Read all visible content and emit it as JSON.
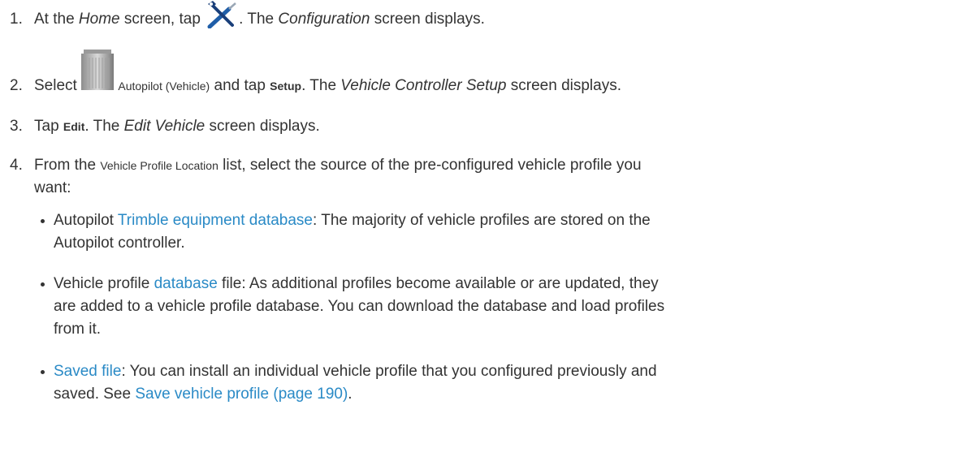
{
  "steps": [
    {
      "number": "1.",
      "p1": "At the ",
      "home": "Home",
      "p2": " screen, tap ",
      "p3": ". The ",
      "configuration": "Configuration",
      "p4": " screen displays.",
      "icon": "wrench-screwdriver-icon"
    },
    {
      "number": "2.",
      "p1": "Select ",
      "autopilot": "Autopilot (Vehicle)",
      "p2": " and tap ",
      "setup": "Setup",
      "p3": ". The ",
      "vcs": "Vehicle Controller Setup",
      "p4": " screen displays.",
      "icon": "autopilot-controller-icon"
    },
    {
      "number": "3.",
      "p1": "Tap ",
      "edit": "Edit",
      "p2": ". The ",
      "edit_vehicle": "Edit Vehicle",
      "p3": " screen displays."
    },
    {
      "number": "4.",
      "p1": "From the ",
      "vpl": "Vehicle Profile Location",
      "p2": " list, select the source of the pre-configured vehicle profile you",
      "line2": "want:"
    }
  ],
  "bullets": [
    {
      "pre": "Autopilot ",
      "link": "Trimble equipment database",
      "post": ": The majority of vehicle profiles are stored on the",
      "line2": "Autopilot controller."
    },
    {
      "pre": "Vehicle profile ",
      "link": "database",
      "post": " file: As additional profiles become available or are updated, they",
      "line2": "are added to a vehicle profile database. You can download the database and load profiles",
      "line3": "from it."
    },
    {
      "link": "Saved file",
      "post": ": You can install an individual vehicle profile that you configured previously and",
      "line2": "saved. See ",
      "link2": "Save vehicle profile (page 190)",
      "line2_end": "."
    }
  ],
  "colors": {
    "text": "#333333",
    "link": "#2a8ac6"
  }
}
